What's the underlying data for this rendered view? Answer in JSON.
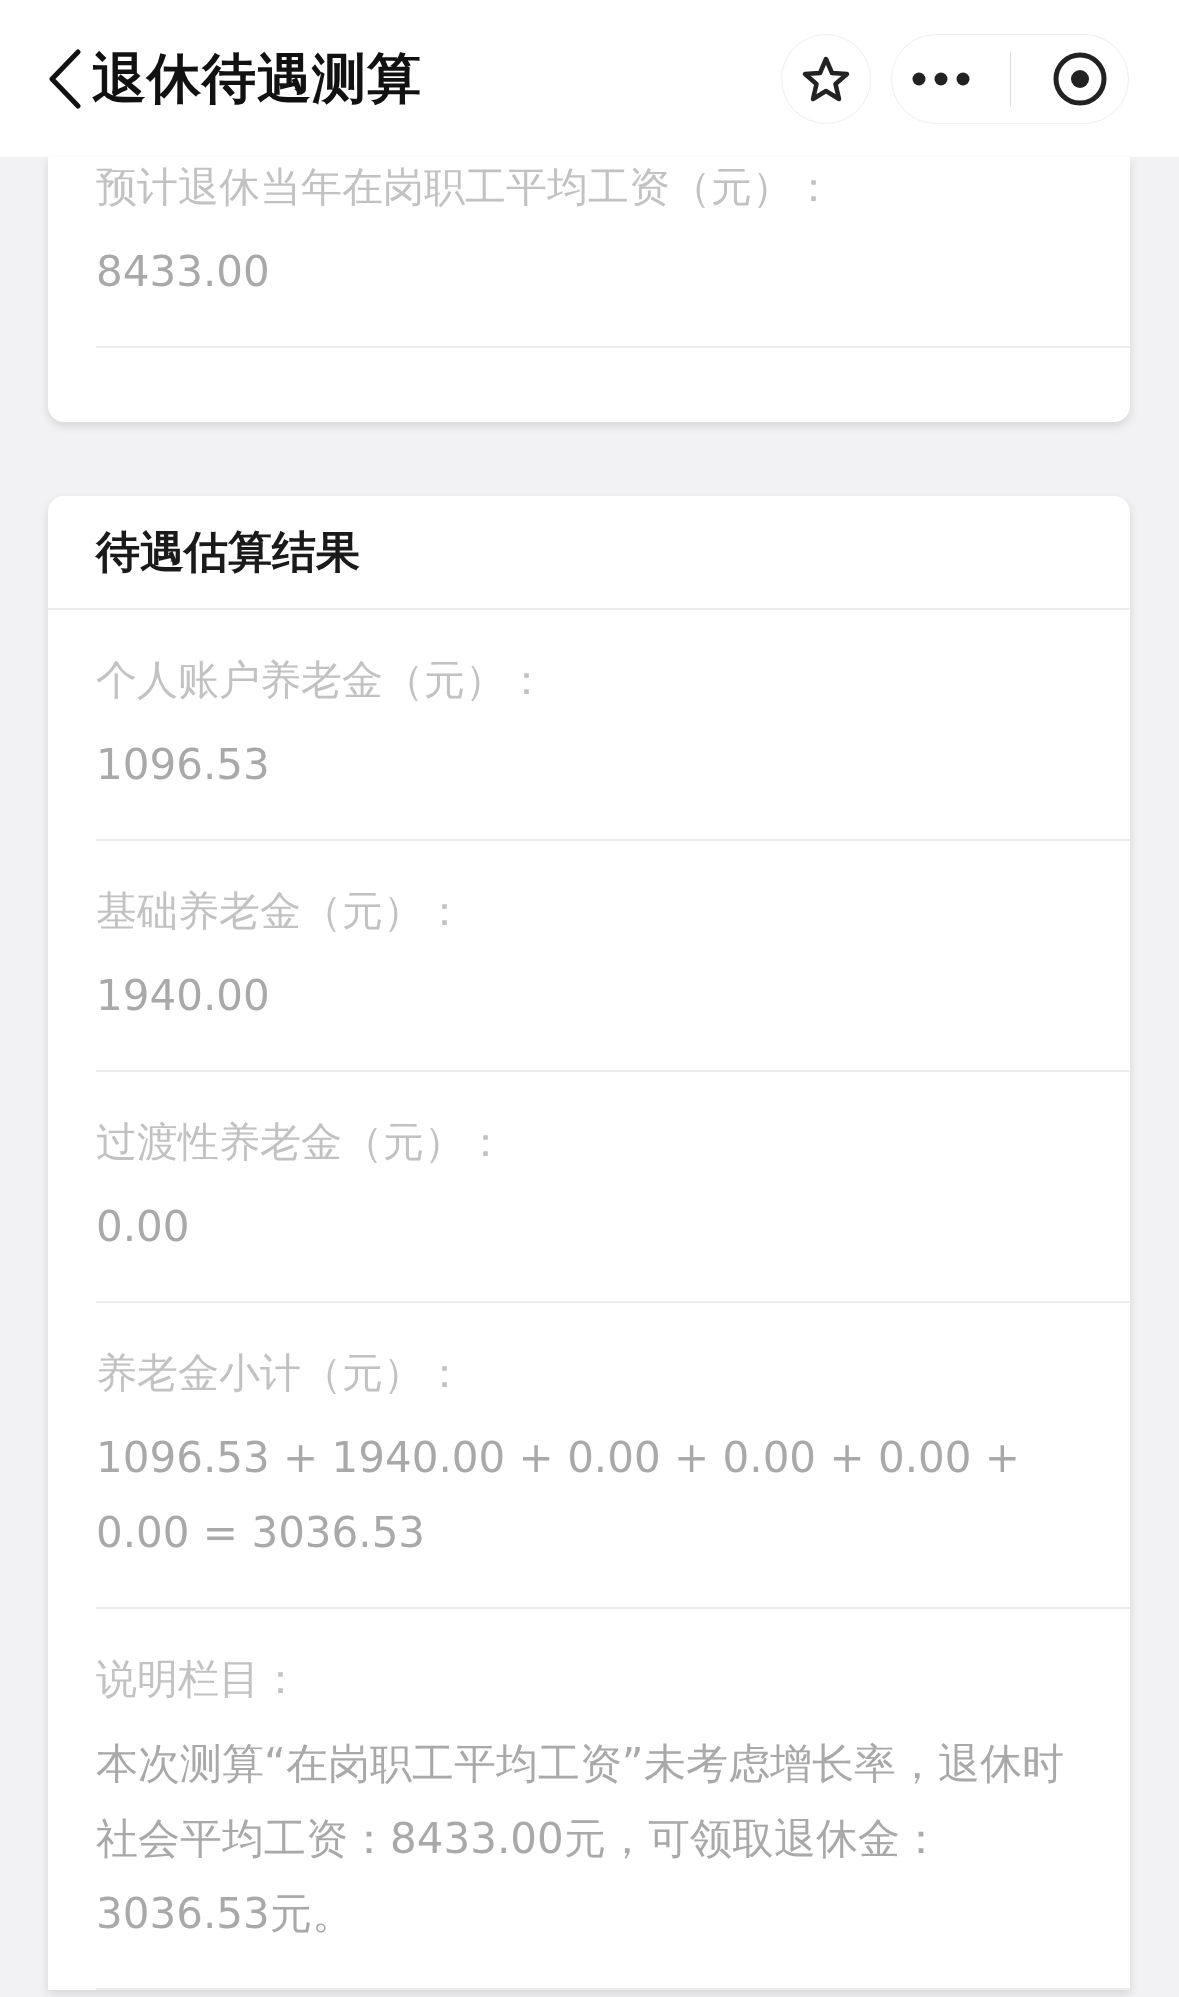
{
  "header": {
    "title": "退休待遇测算"
  },
  "cards": [
    {
      "items": [
        {
          "label": "预计退休当年在岗职工平均工资（元）：",
          "value": "8433.00"
        }
      ]
    },
    {
      "title": "待遇估算结果",
      "items": [
        {
          "label": "个人账户养老金（元）：",
          "value": "1096.53"
        },
        {
          "label": "基础养老金（元）：",
          "value": "1940.00"
        },
        {
          "label": "过渡性养老金（元）：",
          "value": "0.00"
        },
        {
          "label": "养老金小计（元）：",
          "value": "1096.53 + 1940.00 + 0.00 + 0.00 + 0.00 + 0.00 = 3036.53"
        },
        {
          "label": "说明栏目：",
          "value": "本次测算“在岗职工平均工资”未考虑增长率，退休时社会平均工资：8433.00元，可领取退休金：3036.53元。"
        }
      ]
    }
  ]
}
